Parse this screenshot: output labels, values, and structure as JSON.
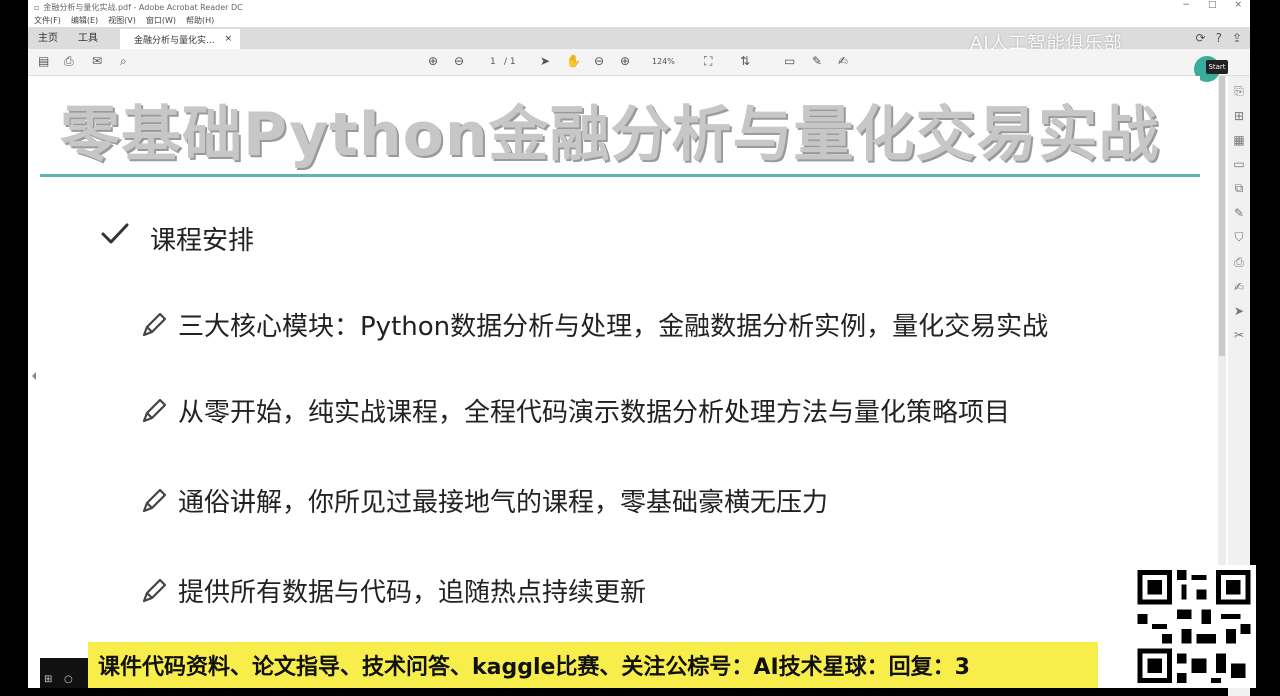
{
  "window": {
    "title": "金融分析与量化实战.pdf - Adobe Acrobat Reader DC",
    "controls": [
      "−",
      "□",
      "×"
    ]
  },
  "menu": [
    "文件(F)",
    "编辑(E)",
    "视图(V)",
    "窗口(W)",
    "帮助(H)"
  ],
  "tabs": {
    "home": "主页",
    "tools": "工具",
    "document": "金融分析与量化实...",
    "close": "×"
  },
  "watermark": "AI人工智能俱乐部",
  "toolbar": {
    "page_current": "1",
    "page_total": "/ 1",
    "zoom": "124%",
    "start_label": "Start"
  },
  "slide": {
    "title": "零基础Python金融分析与量化交易实战",
    "section": "课程安排",
    "items": [
      "三大核心模块：Python数据分析与处理，金融数据分析实例，量化交易实战",
      "从零开始，纯实战课程，全程代码演示数据分析处理方法与量化策略项目",
      "通俗讲解，你所见过最接地气的课程，零基础豪横无压力",
      "提供所有数据与代码，追随热点持续更新"
    ]
  },
  "banner": "课件代码资料、论文指导、技术问答、kaggle比赛、关注公棕号：AI技术星球：回复：3",
  "colors": {
    "rule": "#5fb3b3",
    "banner": "#f7ee4b",
    "title": "#c7c7c7"
  }
}
